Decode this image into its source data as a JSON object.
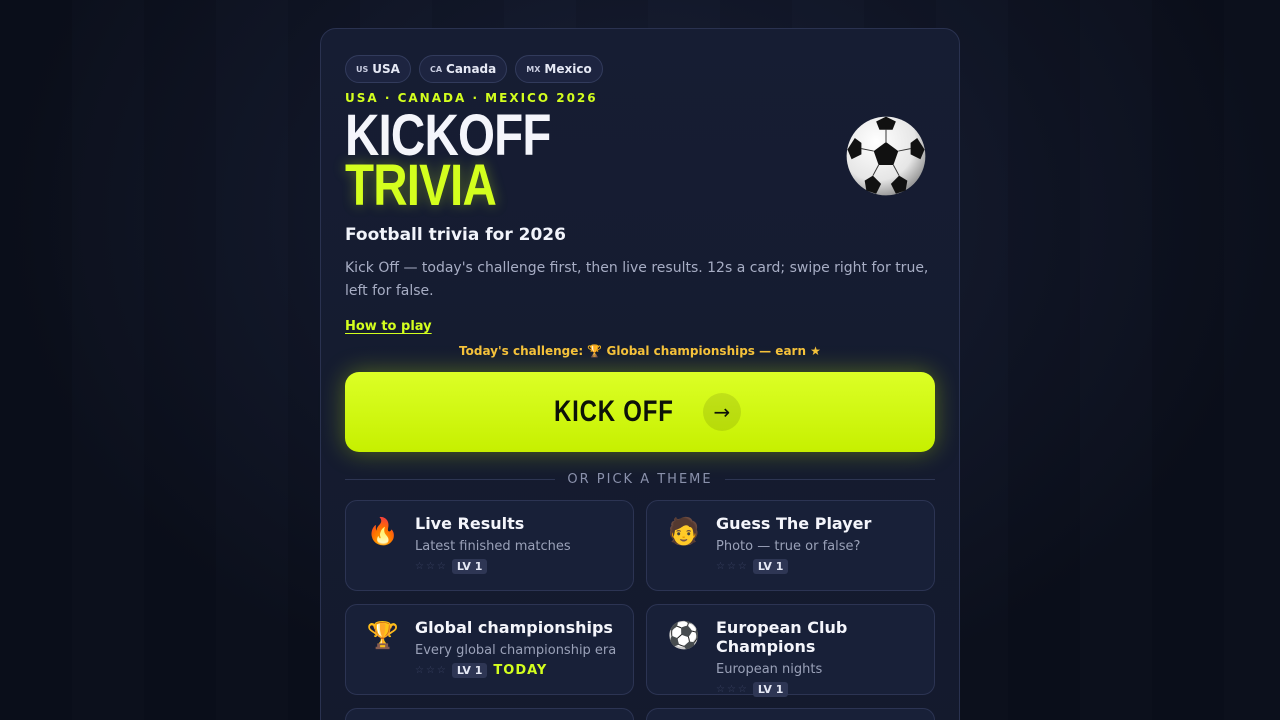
{
  "hosts": [
    {
      "code": "US",
      "name": "USA"
    },
    {
      "code": "CA",
      "name": "Canada"
    },
    {
      "code": "MX",
      "name": "Mexico"
    }
  ],
  "hero": {
    "kicker": "USA · CANADA · MEXICO 2026",
    "title_line1": "KICKOFF",
    "title_line2": "TRIVIA",
    "ball_icon": "soccer-ball-icon",
    "subtitle": "Football trivia for 2026",
    "description": "Kick Off — today's challenge first, then live results. 12s a card; swipe right for true, left for false.",
    "how_to_play": "How to play",
    "challenge": "Today's challenge: 🏆 Global championships — earn ★"
  },
  "cta": {
    "label": "KICK OFF",
    "arrow": "→"
  },
  "divider": "OR PICK A THEME",
  "themes": [
    {
      "icon": "🔥",
      "name": "Live Results",
      "sub": "Latest finished matches",
      "stars": "☆☆☆",
      "level": "LV 1",
      "badge": ""
    },
    {
      "icon": "🧑",
      "name": "Guess The Player",
      "sub": "Photo — true or false?",
      "stars": "☆☆☆",
      "level": "LV 1",
      "badge": ""
    },
    {
      "icon": "🏆",
      "name": "Global championships",
      "sub": "Every global championship era",
      "stars": "☆☆☆",
      "level": "LV 1",
      "badge": "TODAY"
    },
    {
      "icon": "⚽",
      "name": "European Club Champions",
      "sub": "European nights",
      "stars": "☆☆☆",
      "level": "LV 1",
      "badge": ""
    }
  ],
  "colors": {
    "accent": "#d4ff1e",
    "gold": "#f5c23a",
    "bg": "#0e1322",
    "card": "#161d33"
  }
}
